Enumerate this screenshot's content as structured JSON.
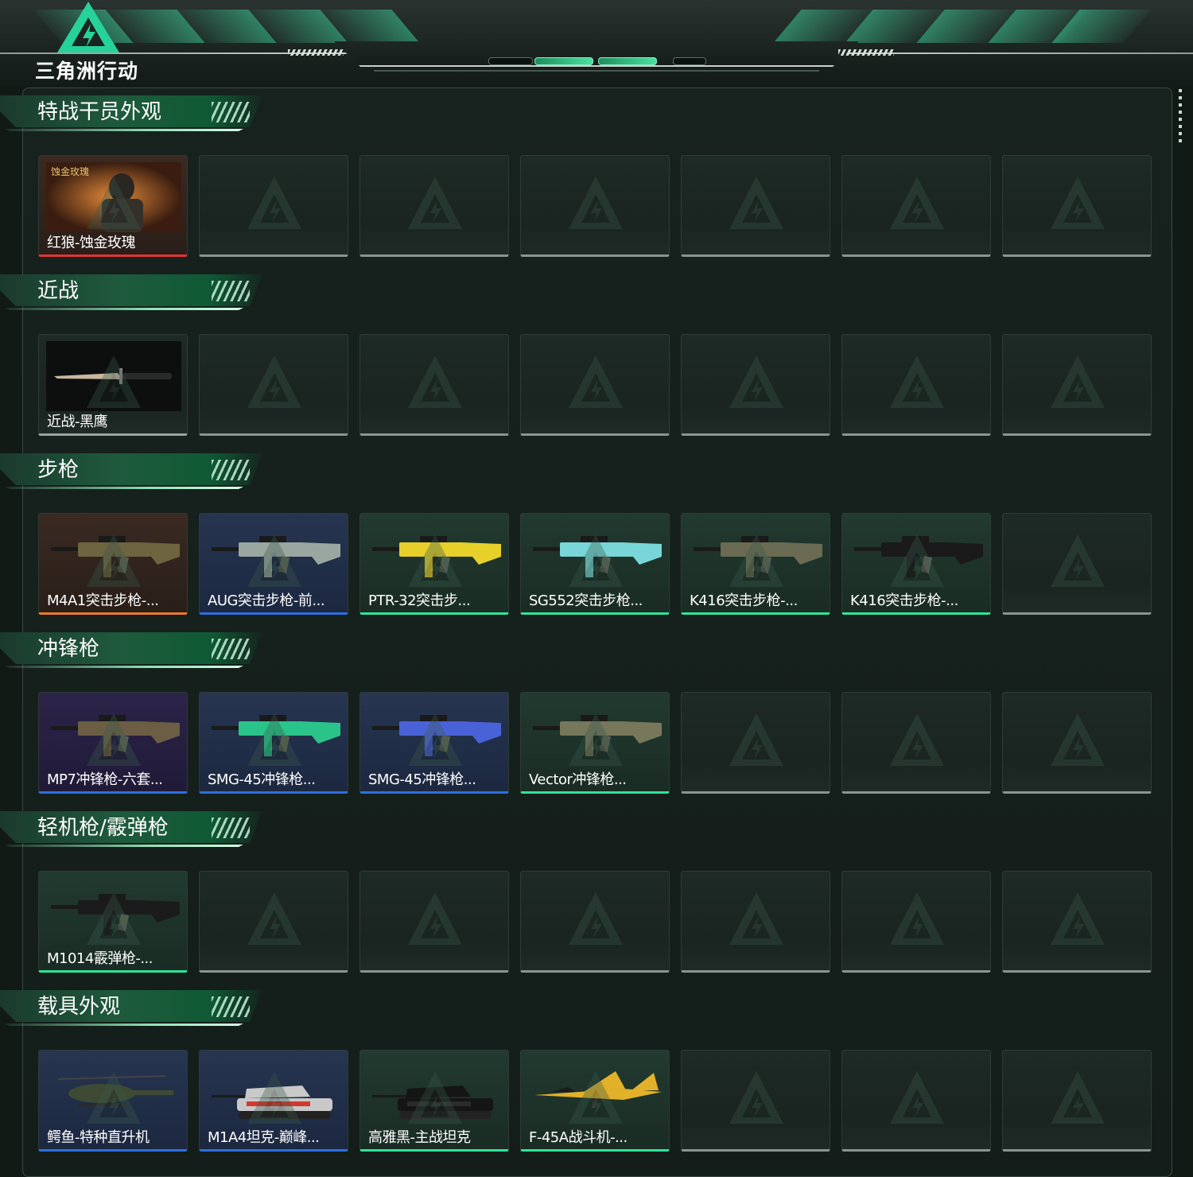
{
  "header": {
    "logo_text": "三角洲行动"
  },
  "colors": {
    "accent": "#2ee59a",
    "rarity_red": "#e03535",
    "rarity_orange": "#ee7a2a",
    "rarity_blue": "#2e6fe0",
    "rarity_green": "#2ee59a",
    "empty_bar": "#8b958f"
  },
  "sections": [
    {
      "title": "特战干员外观",
      "items": [
        {
          "label": "红狼-蚀金玫瑰",
          "rarity": "red",
          "image_caption": "蚀金玫瑰",
          "icon": "operator-skin-image"
        }
      ]
    },
    {
      "title": "近战",
      "items": [
        {
          "label": "近战-黑鹰",
          "rarity": "gray",
          "icon": "knife-image"
        }
      ]
    },
    {
      "title": "步枪",
      "items": [
        {
          "label": "M4A1突击步枪-...",
          "rarity": "orange",
          "icon": "rifle-image"
        },
        {
          "label": "AUG突击步枪-前...",
          "rarity": "blue",
          "icon": "rifle-image"
        },
        {
          "label": "PTR-32突击步...",
          "rarity": "green",
          "icon": "rifle-image"
        },
        {
          "label": "SG552突击步枪...",
          "rarity": "green",
          "icon": "rifle-image"
        },
        {
          "label": "K416突击步枪-...",
          "rarity": "green",
          "icon": "rifle-image"
        },
        {
          "label": "K416突击步枪-...",
          "rarity": "green",
          "icon": "rifle-image"
        }
      ]
    },
    {
      "title": "冲锋枪",
      "items": [
        {
          "label": "MP7冲锋枪-六套...",
          "rarity": "purple",
          "icon": "smg-image"
        },
        {
          "label": "SMG-45冲锋枪...",
          "rarity": "blue",
          "icon": "smg-image"
        },
        {
          "label": "SMG-45冲锋枪...",
          "rarity": "blue",
          "icon": "smg-image"
        },
        {
          "label": "Vector冲锋枪...",
          "rarity": "green",
          "icon": "smg-image"
        }
      ]
    },
    {
      "title": "轻机枪/霰弹枪",
      "items": [
        {
          "label": "M1014霰弹枪-...",
          "rarity": "green",
          "icon": "shotgun-image"
        }
      ]
    },
    {
      "title": "载具外观",
      "items": [
        {
          "label": "鳄鱼-特种直升机",
          "rarity": "blue",
          "icon": "helicopter-image"
        },
        {
          "label": "M1A4坦克-巅峰...",
          "rarity": "blue",
          "icon": "tank-image"
        },
        {
          "label": "高雅黑-主战坦克",
          "rarity": "green",
          "icon": "tank-image"
        },
        {
          "label": "F-45A战斗机-...",
          "rarity": "green",
          "icon": "jet-image"
        }
      ]
    }
  ]
}
